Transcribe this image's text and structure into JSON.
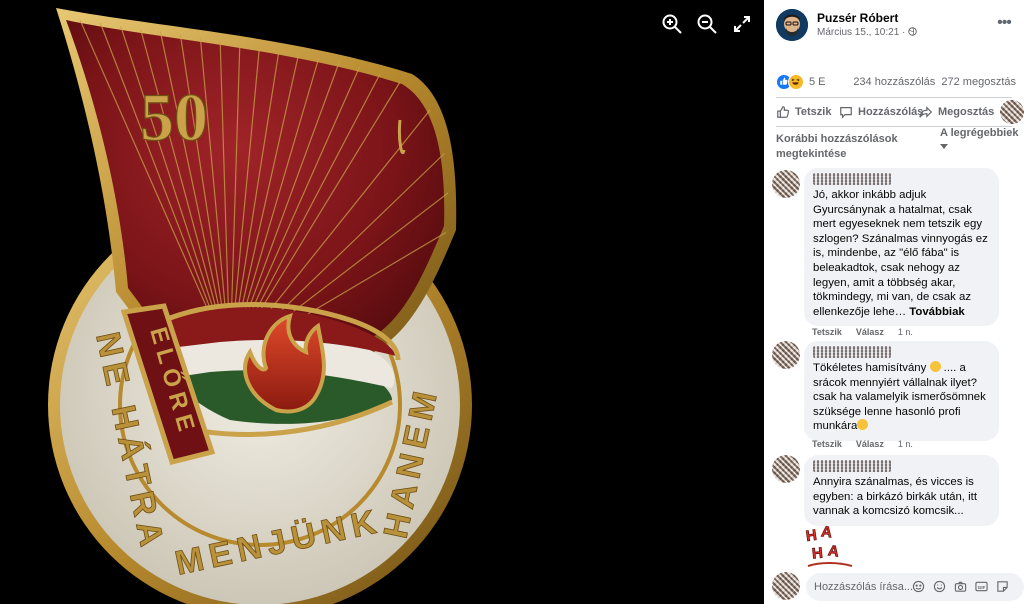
{
  "viewer": {
    "badge": {
      "number": "50",
      "banner_text": "ELŐRE",
      "ring_left": "NE HÁTRA",
      "ring_bottom": "MENJÜNK",
      "ring_right": "HANEM"
    },
    "tools": [
      "zoom-in-icon",
      "zoom-out-icon",
      "fullscreen-icon"
    ]
  },
  "post": {
    "author": "Puzsér Róbert",
    "timestamp": "Március 15., 10:21 ·",
    "reaction_count": "5 E",
    "comments_count": "234 hozzászólás",
    "shares_count": "272 megosztás"
  },
  "actions": {
    "like": "Tetszik",
    "comment": "Hozzászólás",
    "share": "Megosztás"
  },
  "comments_section": {
    "previous": "Korábbi hozzászólások megtekintése",
    "sort": "A legrégebbiek",
    "comments": [
      {
        "text": "Jó, akkor inkább adjuk Gyurcsánynak a hatalmat, csak mert egyeseknek nem tetszik egy szlogen? Szánalmas vinnyogás ez is, mindenbe, az \"élő fába\" is beleakadtok, csak nehogy az legyen, amit a többség akar, tökmindegy, mi van, de csak az ellenkezője lehe…",
        "more": "Továbbiak",
        "like": "Tetszik",
        "reply": "Válasz",
        "time": "1 n."
      },
      {
        "text_a": "Tökéletes hamisítvány",
        "text_b": ".... a srácok mennyiért vállalnak ilyet? csak ha valamelyik ismerősömnek szüksége lenne hasonló profi munkára",
        "like": "Tetszik",
        "reply": "Válasz",
        "time": "1 n."
      },
      {
        "text": "Annyira szánalmas, és vicces is egyben: a birkázó birkák után, itt vannak a komcsizó komcsik...",
        "sticker": "HA HA"
      }
    ],
    "write_placeholder": "Hozzászólás írása..."
  },
  "colors": {
    "badge_red": "#7a1418",
    "badge_gold": "#c9a24a",
    "badge_cream": "#e6e2d6",
    "fb_gray_text": "#65676b",
    "bubble_bg": "#f0f2f5"
  }
}
